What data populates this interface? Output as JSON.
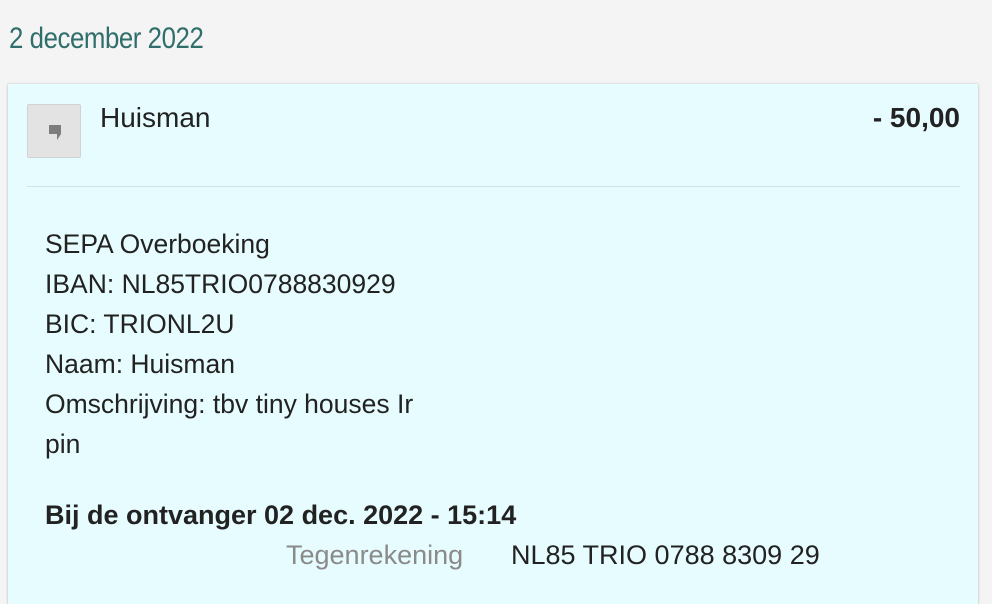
{
  "date_heading": "2 december 2022",
  "transaction": {
    "counterparty": "Huisman",
    "amount": "- 50,00",
    "logo_icon": "bank-logo-placeholder-icon",
    "details": [
      "SEPA Overboeking",
      "IBAN: NL85TRIO0788830929",
      "BIC: TRIONL2U",
      "Naam: Huisman",
      "Omschrijving: tbv tiny houses Ir",
      "pin"
    ],
    "timestamp": "Bij de ontvanger 02 dec. 2022 - 15:14",
    "counter_account_label": "Tegenrekening",
    "counter_account_value": "NL85 TRIO 0788 8309 29"
  },
  "colors": {
    "date_heading": "#2f6e6b",
    "card_background": "#e7fcfe",
    "page_background": "#f4f4f4",
    "label_gray": "#8a8a8a"
  }
}
